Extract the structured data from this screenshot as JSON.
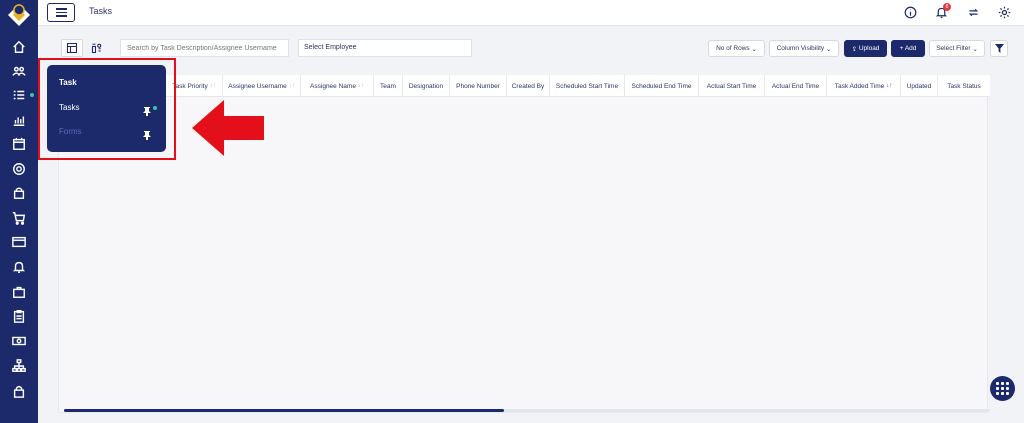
{
  "header": {
    "title": "Tasks",
    "notification_count": "8"
  },
  "toolbar": {
    "search_placeholder": "Search by Task Description/Assignee Username",
    "employee_select": "Select Employee",
    "rows_label": "No of Rows",
    "column_visibility_label": "Column Visibility",
    "upload_label": "Upload",
    "add_label": "+ Add",
    "select_filter_label": "Select Filter"
  },
  "table": {
    "columns": [
      "Task Priority",
      "Assignee Username",
      "Assignee Name",
      "Team",
      "Designation",
      "Phone Number",
      "Created By",
      "Scheduled Start Time",
      "Scheduled End Time",
      "Actual Start Time",
      "Actual End Time",
      "Task Added Time",
      "Updated",
      "Task Status"
    ],
    "rows": []
  },
  "flyout": {
    "title": "Task",
    "items": [
      {
        "label": "Tasks",
        "active": true
      },
      {
        "label": "Forms",
        "active": false
      }
    ]
  },
  "sidebar": {
    "icons": [
      "home-icon",
      "team-icon",
      "tasks-icon",
      "reports-icon",
      "calendar-icon",
      "target-icon",
      "bag-icon",
      "cart-icon",
      "card-icon",
      "bell-icon",
      "briefcase-icon",
      "clipboard-icon",
      "cash-icon",
      "hierarchy-icon",
      "lock-icon"
    ]
  },
  "colors": {
    "brand": "#1c2a6b",
    "accent": "#38c6a8",
    "highlight": "#e3101b"
  }
}
